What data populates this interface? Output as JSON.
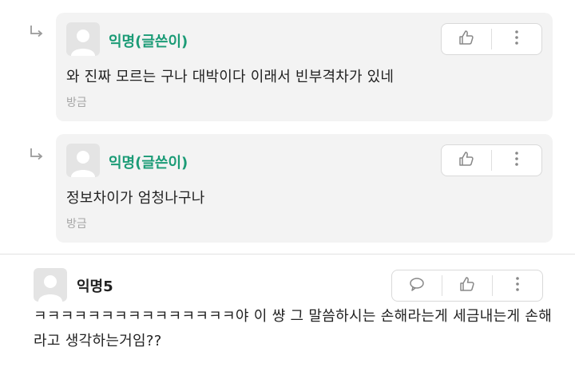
{
  "replies": [
    {
      "author": "익명(글쓴이)",
      "text": "와 진짜 모르는 구나 대박이다 이래서 빈부격차가 있네",
      "time": "방금"
    },
    {
      "author": "익명(글쓴이)",
      "text": "정보차이가 엄청나구나",
      "time": "방금"
    }
  ],
  "comment": {
    "author": "익명5",
    "text": "ㅋㅋㅋㅋㅋㅋㅋㅋㅋㅋㅋㅋㅋㅋㅋ야 이 썅 그 말씀하시는 손해라는게 세금내는게 손해라고 생각하는거임??"
  },
  "icons": {
    "reply_arrow": "reply-arrow-icon",
    "like": "thumbs-up-icon",
    "more": "more-vertical-icon",
    "comment": "comment-bubble-icon"
  },
  "colors": {
    "op_author": "#1b9b76",
    "card_bg": "#f3f3f3",
    "time": "#a6a6a6"
  }
}
